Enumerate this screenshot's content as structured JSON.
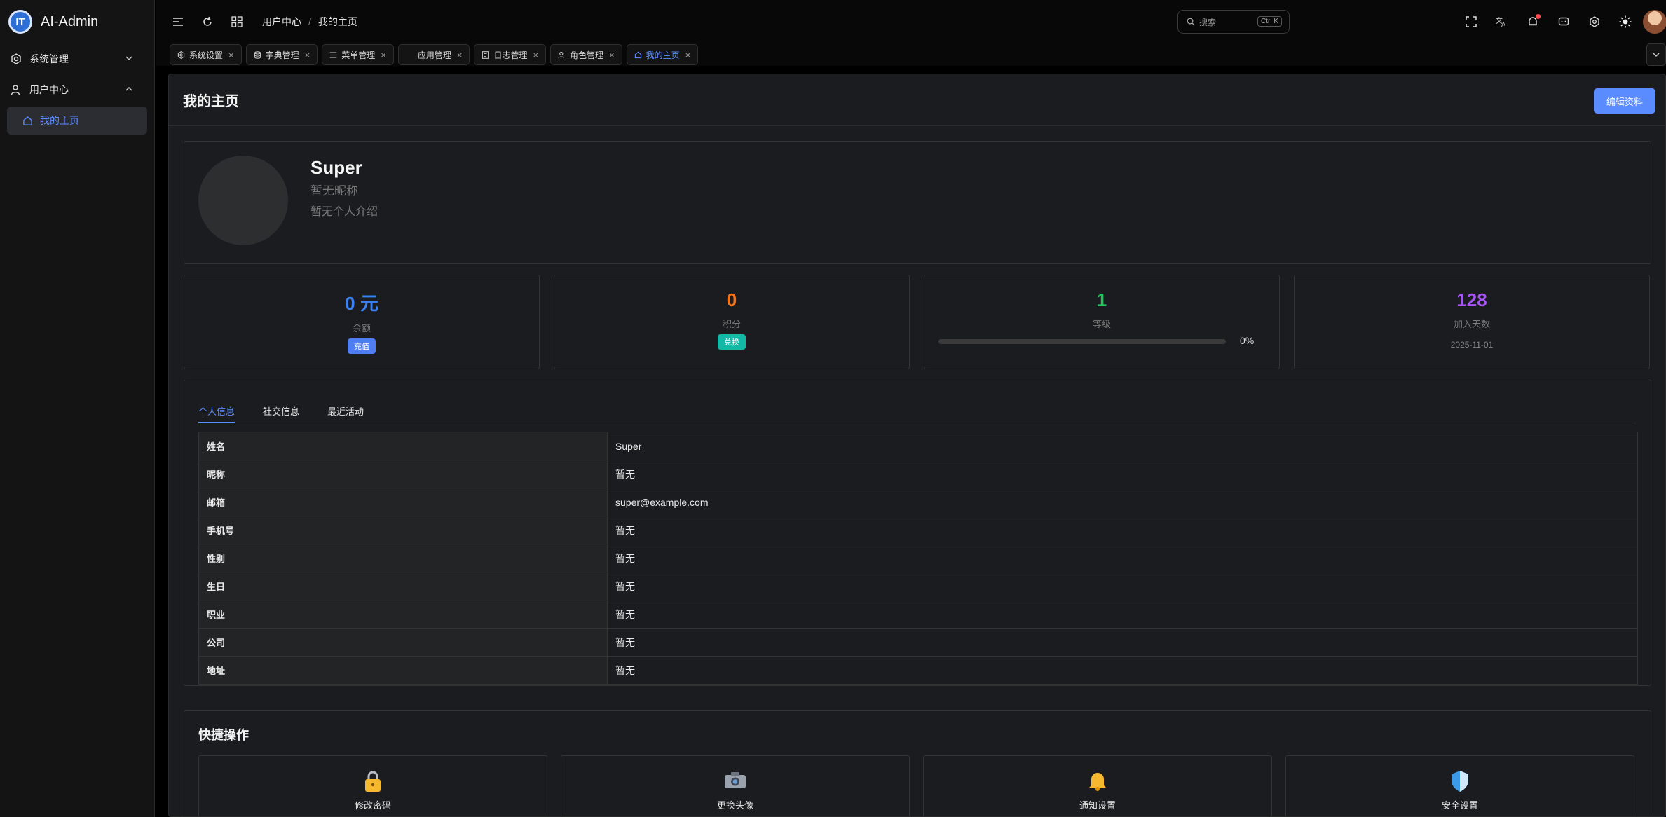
{
  "app": {
    "title": "AI-Admin"
  },
  "sidebar": {
    "items": [
      {
        "label": "系统管理",
        "icon": "gear-icon"
      },
      {
        "label": "用户中心",
        "icon": "user-icon"
      }
    ],
    "sub_items": [
      {
        "label": "我的主页",
        "icon": "home-icon"
      }
    ]
  },
  "breadcrumb": [
    "用户中心",
    "我的主页"
  ],
  "search": {
    "placeholder": "搜索",
    "shortcut": "Ctrl K"
  },
  "tabs": [
    {
      "label": "系统设置",
      "icon": "gear-icon"
    },
    {
      "label": "字典管理",
      "icon": "database-icon"
    },
    {
      "label": "菜单管理",
      "icon": "menu-icon"
    },
    {
      "label": "应用管理",
      "icon": "app-icon"
    },
    {
      "label": "日志管理",
      "icon": "log-icon"
    },
    {
      "label": "角色管理",
      "icon": "role-icon"
    },
    {
      "label": "我的主页",
      "icon": "home-icon",
      "active": true
    }
  ],
  "page": {
    "title": "我的主页",
    "edit_label": "编辑资料"
  },
  "profile": {
    "name": "Super",
    "nickname": "暂无昵称",
    "bio": "暂无个人介绍"
  },
  "stats": {
    "balance": {
      "value": "0 元",
      "label": "余额",
      "action": "充值",
      "color": "#3b82f6"
    },
    "points": {
      "value": "0",
      "label": "积分",
      "action": "兑换",
      "color": "#f97316"
    },
    "level": {
      "value": "1",
      "label": "等级",
      "progress": 0,
      "progress_text": "0%",
      "color": "#22c55e"
    },
    "days": {
      "value": "128",
      "label": "加入天数",
      "date": "2025-11-01",
      "color": "#a855f7"
    }
  },
  "info_tabs": [
    "个人信息",
    "社交信息",
    "最近活动"
  ],
  "info_rows": [
    {
      "k": "姓名",
      "v": "Super"
    },
    {
      "k": "昵称",
      "v": "暂无"
    },
    {
      "k": "邮箱",
      "v": "super@example.com"
    },
    {
      "k": "手机号",
      "v": "暂无"
    },
    {
      "k": "性别",
      "v": "暂无"
    },
    {
      "k": "生日",
      "v": "暂无"
    },
    {
      "k": "职业",
      "v": "暂无"
    },
    {
      "k": "公司",
      "v": "暂无"
    },
    {
      "k": "地址",
      "v": "暂无"
    }
  ],
  "quick": {
    "title": "快捷操作",
    "items": [
      {
        "label": "修改密码",
        "icon": "lock-icon"
      },
      {
        "label": "更换头像",
        "icon": "camera-icon"
      },
      {
        "label": "通知设置",
        "icon": "bell-icon"
      },
      {
        "label": "安全设置",
        "icon": "shield-icon"
      }
    ]
  },
  "colors": {
    "accent": "#5b8cff",
    "points_pill": "#14b8a6"
  }
}
